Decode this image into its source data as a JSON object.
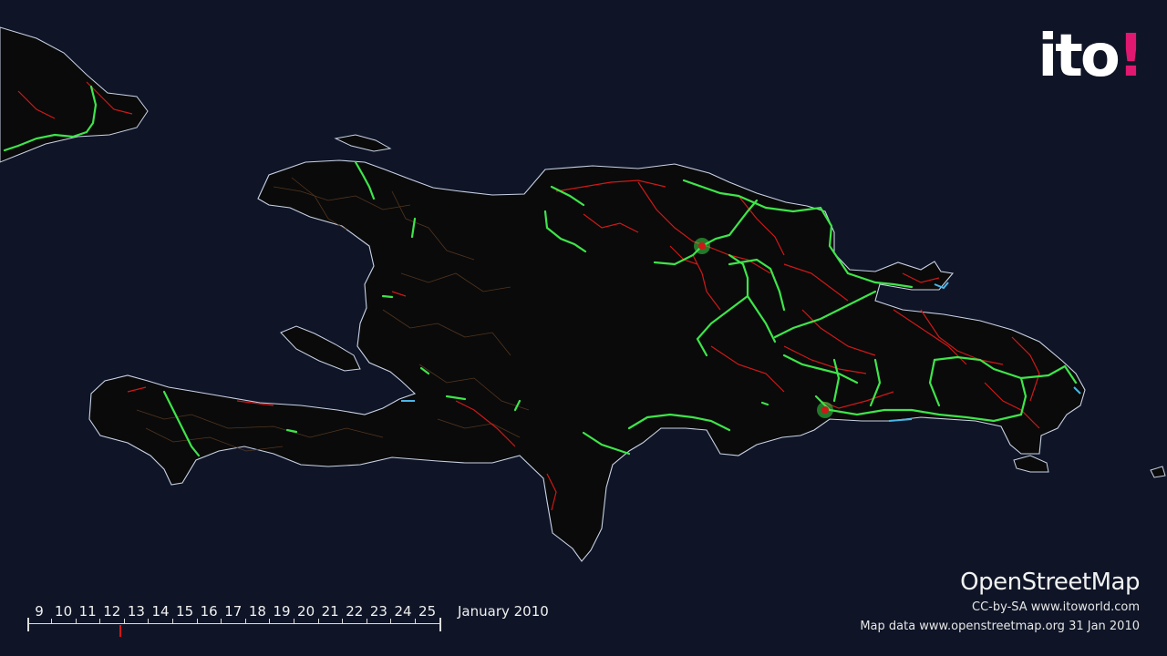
{
  "logo": {
    "text": "ito",
    "mark": "!"
  },
  "credits": {
    "title": "OpenStreetMap",
    "license": "CC-by-SA www.itoworld.com",
    "source": "Map data www.openstreetmap.org 31 Jan 2010"
  },
  "timeline": {
    "days": [
      "9",
      "10",
      "11",
      "12",
      "13",
      "14",
      "15",
      "16",
      "17",
      "18",
      "19",
      "20",
      "21",
      "22",
      "23",
      "24",
      "25"
    ],
    "month": "January 2010",
    "current_day": 12.3
  },
  "legend_colors": {
    "background": "#0f1527",
    "land": "#0a0a0a",
    "coast": "#c9d3e6",
    "new_road": "#3ee54a",
    "edited_road": "#d01818",
    "minor_road": "#5a3a22",
    "water": "#49b6e6"
  }
}
